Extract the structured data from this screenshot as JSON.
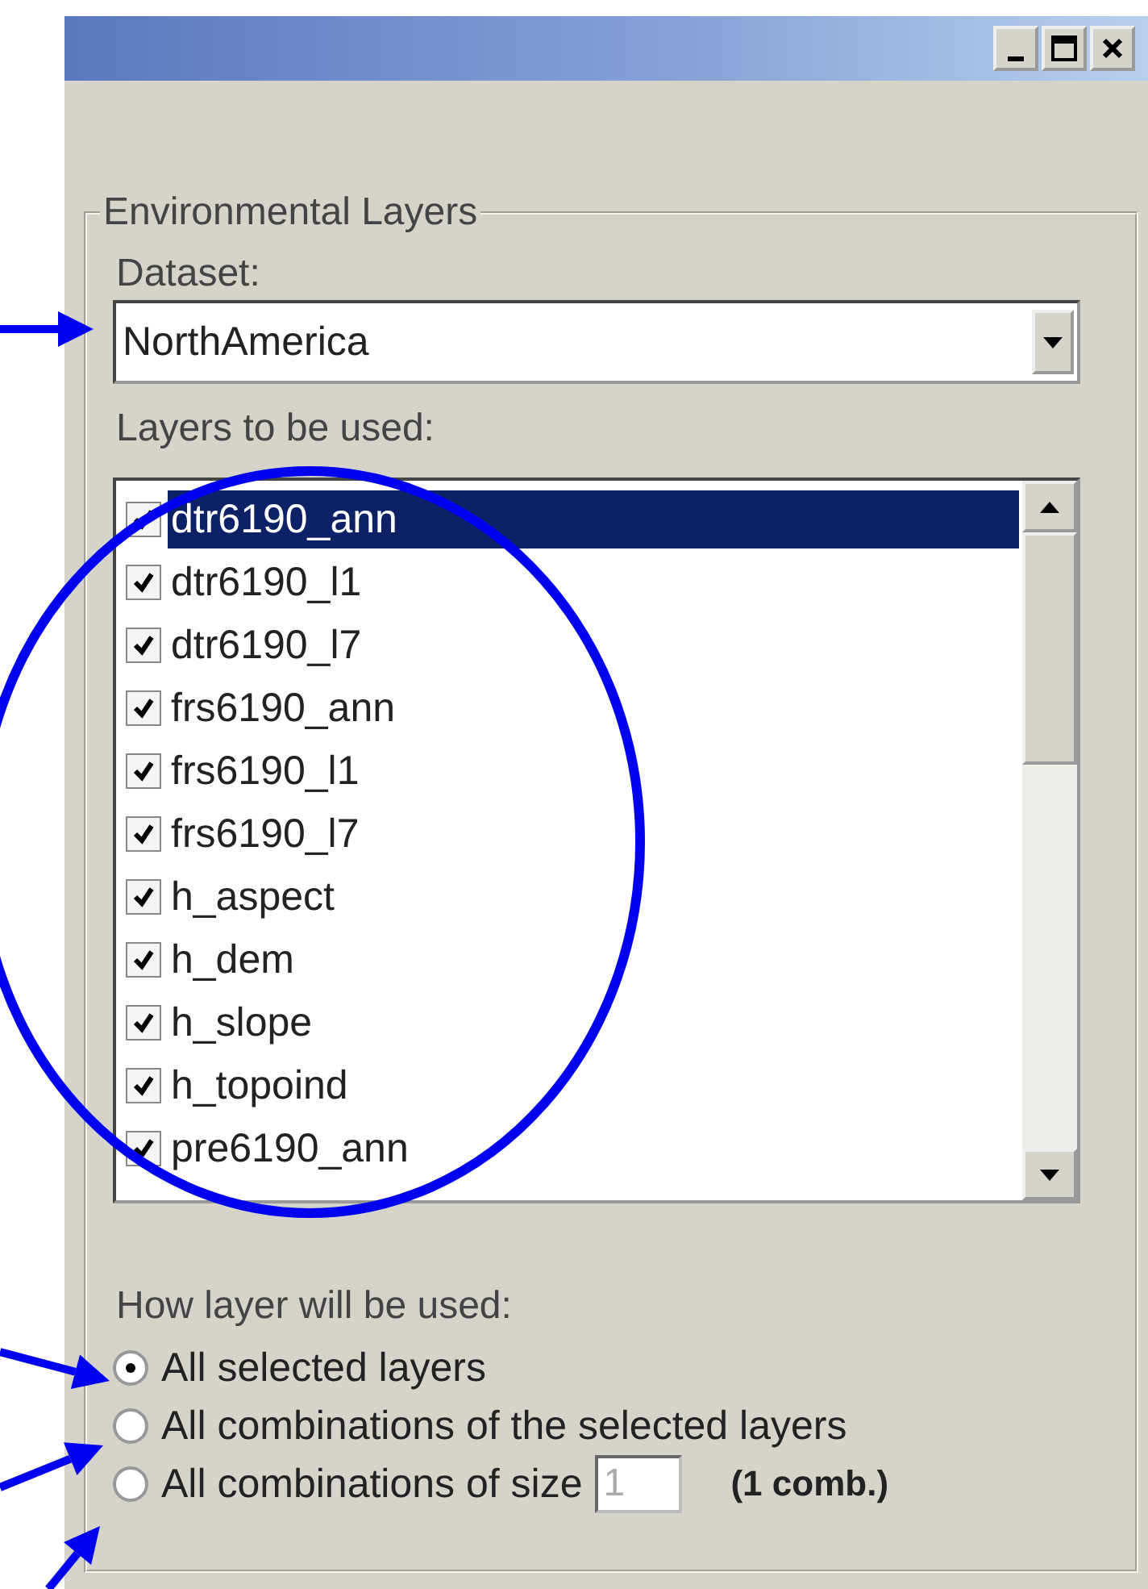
{
  "title_buttons": [
    {
      "kind": "minimize"
    },
    {
      "kind": "maximize"
    },
    {
      "kind": "close"
    }
  ],
  "group": {
    "title": "Environmental Layers",
    "dataset": {
      "label": "Dataset:",
      "value": "NorthAmerica"
    },
    "layers": {
      "label": "Layers to be used:",
      "items": [
        {
          "name": "dtr6190_ann",
          "checked": true,
          "selected": true
        },
        {
          "name": "dtr6190_l1",
          "checked": true,
          "selected": false
        },
        {
          "name": "dtr6190_l7",
          "checked": true,
          "selected": false
        },
        {
          "name": "frs6190_ann",
          "checked": true,
          "selected": false
        },
        {
          "name": "frs6190_l1",
          "checked": true,
          "selected": false
        },
        {
          "name": "frs6190_l7",
          "checked": true,
          "selected": false
        },
        {
          "name": "h_aspect",
          "checked": true,
          "selected": false
        },
        {
          "name": "h_dem",
          "checked": true,
          "selected": false
        },
        {
          "name": "h_slope",
          "checked": true,
          "selected": false
        },
        {
          "name": "h_topoind",
          "checked": true,
          "selected": false
        },
        {
          "name": "pre6190_ann",
          "checked": true,
          "selected": false
        }
      ]
    },
    "usage": {
      "label": "How layer will be used:",
      "options": [
        {
          "label": "All selected layers",
          "selected": true
        },
        {
          "label": "All combinations of the selected layers",
          "selected": false
        },
        {
          "label": "All combinations of size",
          "selected": false
        }
      ],
      "size": {
        "value": "1",
        "disabled": true,
        "note": "(1 comb.)"
      }
    }
  }
}
